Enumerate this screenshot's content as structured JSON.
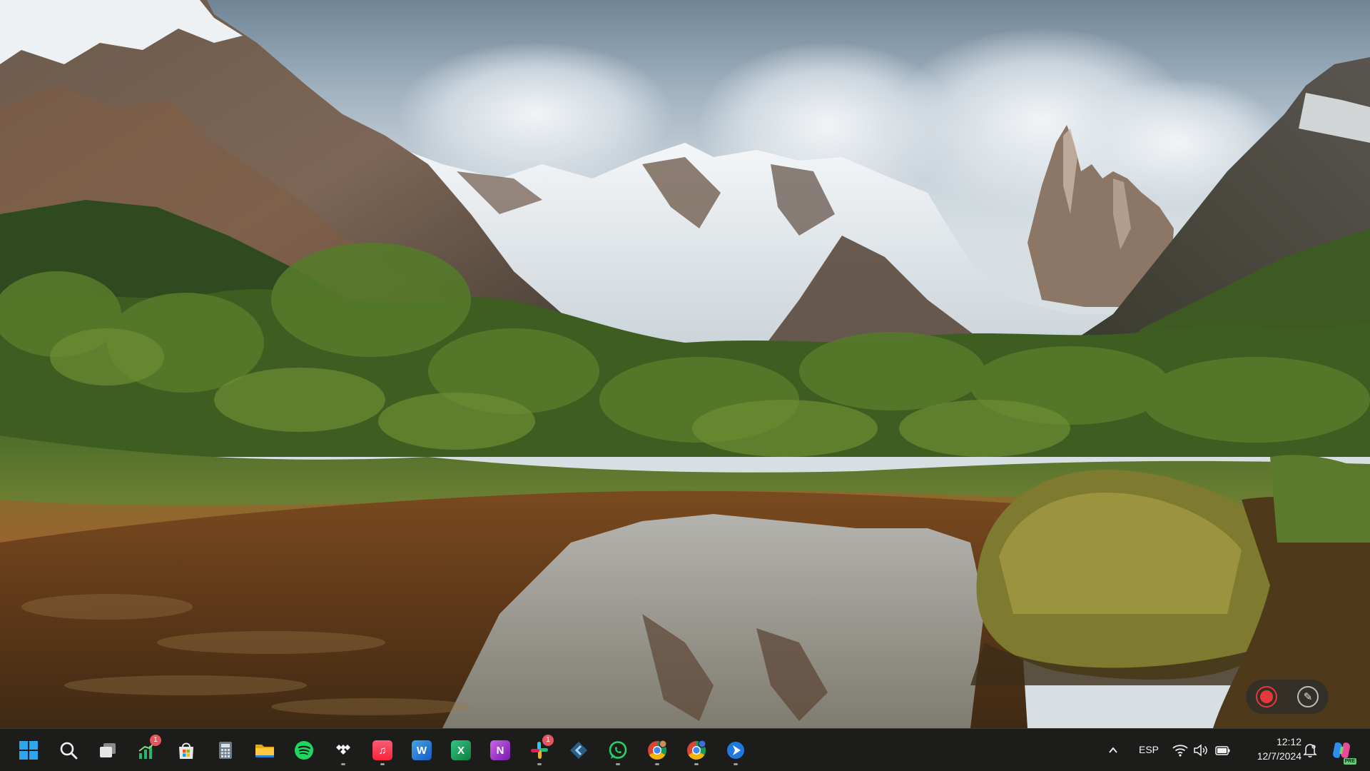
{
  "wallpaper": {
    "description_icon": "mountain-landscape-wallpaper"
  },
  "recorder_widget": {
    "record_icon": "record-icon",
    "pen_icon": "pen-icon",
    "record_color": "#e23a3a"
  },
  "taskbar": {
    "pinned": [
      {
        "name": "start-button",
        "icon": "windows-logo-icon",
        "badge": ""
      },
      {
        "name": "search-button",
        "icon": "search-icon",
        "badge": ""
      },
      {
        "name": "task-view-button",
        "icon": "task-view-icon",
        "badge": ""
      },
      {
        "name": "app-stocks",
        "icon": "chart-icon",
        "badge": "1"
      },
      {
        "name": "app-microsoft-store",
        "icon": "store-icon",
        "badge": ""
      },
      {
        "name": "app-calculator",
        "icon": "calculator-icon",
        "badge": ""
      },
      {
        "name": "app-file-explorer",
        "icon": "folder-icon",
        "badge": ""
      },
      {
        "name": "app-spotify",
        "icon": "spotify-icon",
        "badge": ""
      },
      {
        "name": "app-tidal",
        "icon": "tidal-icon",
        "badge": ""
      },
      {
        "name": "app-apple-music",
        "icon": "music-icon",
        "badge": ""
      },
      {
        "name": "app-word",
        "icon": "word-icon",
        "badge": "",
        "letter": "W"
      },
      {
        "name": "app-excel",
        "icon": "excel-icon",
        "badge": "",
        "letter": "X"
      },
      {
        "name": "app-onenote",
        "icon": "onenote-icon",
        "badge": "",
        "letter": "N"
      },
      {
        "name": "app-slack",
        "icon": "slack-icon",
        "badge": "1"
      },
      {
        "name": "app-kodi",
        "icon": "kodi-icon",
        "badge": ""
      },
      {
        "name": "app-whatsapp",
        "icon": "whatsapp-icon",
        "badge": ""
      },
      {
        "name": "app-chrome-profile-1",
        "icon": "chrome-icon",
        "badge": ""
      },
      {
        "name": "app-chrome-profile-2",
        "icon": "chrome-icon",
        "badge": ""
      },
      {
        "name": "app-remote-desktop",
        "icon": "play-arrow-icon",
        "badge": ""
      }
    ],
    "tray": {
      "overflow_icon": "chevron-up-icon",
      "language": "ESP",
      "wifi_icon": "wifi-icon",
      "volume_icon": "volume-icon",
      "battery_icon": "battery-icon",
      "time": "12:12",
      "date": "12/7/2024",
      "notifications_icon": "notification-bell-icon",
      "copilot_icon": "copilot-icon",
      "copilot_badge": "PRE"
    }
  }
}
